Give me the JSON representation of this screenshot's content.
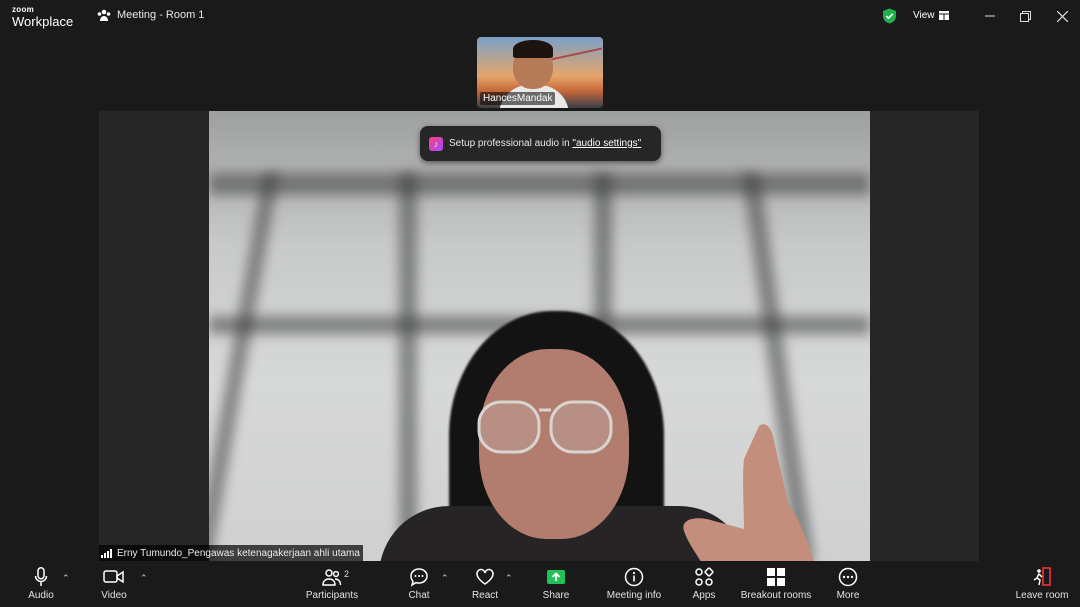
{
  "app": {
    "brand_top": "zoom",
    "brand_bottom": "Workplace"
  },
  "window": {
    "title": "Meeting - Room 1",
    "view_label": "View"
  },
  "self_view": {
    "name": "HancesMandak"
  },
  "toast": {
    "text_prefix": "Setup professional audio in ",
    "link": "\"audio settings\""
  },
  "speaker": {
    "name": "Erny Tumundo_Pengawas ketenagakerjaan ahli utama"
  },
  "toolbar": {
    "audio": "Audio",
    "video": "Video",
    "participants": "Participants",
    "participants_count": "2",
    "chat": "Chat",
    "react": "React",
    "share": "Share",
    "meeting_info": "Meeting info",
    "apps": "Apps",
    "breakout": "Breakout rooms",
    "more": "More",
    "leave": "Leave room"
  },
  "colors": {
    "share_green": "#22c25a",
    "shield_green": "#1fb14c",
    "leave_red": "#e02f2f"
  }
}
